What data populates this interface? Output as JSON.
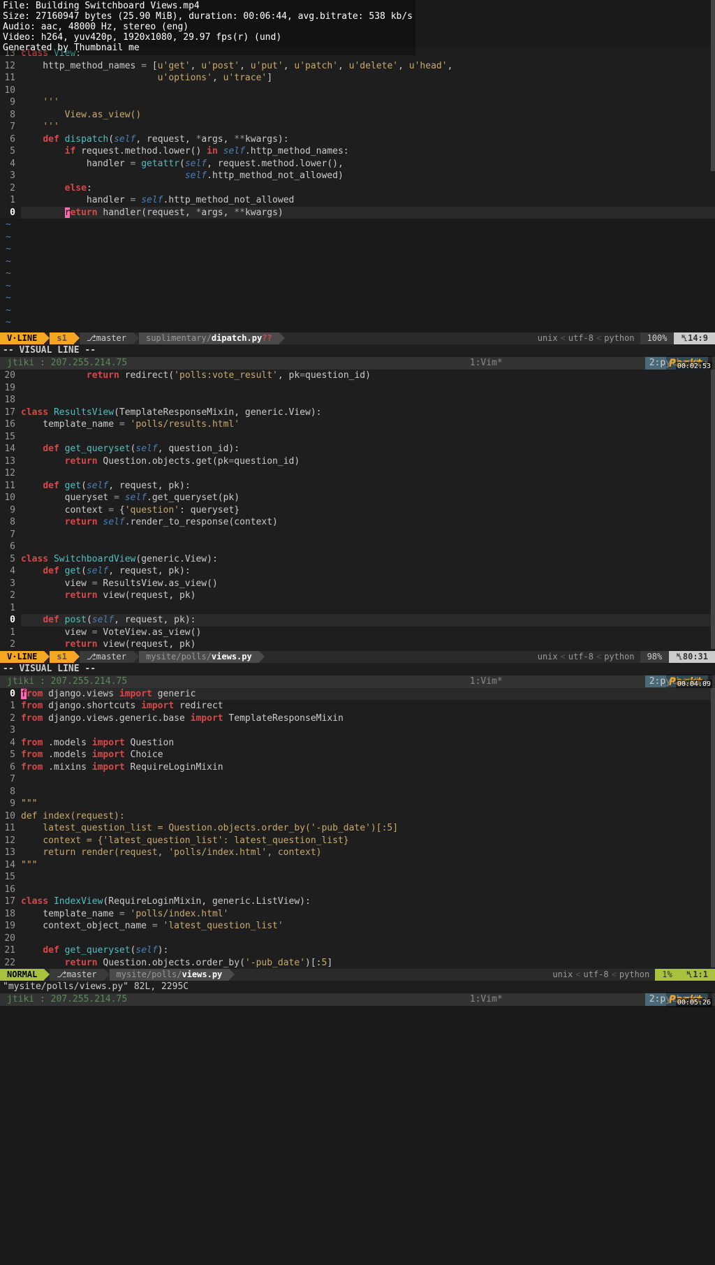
{
  "meta": {
    "file": "File: Building Switchboard Views.mp4",
    "size": "Size: 27160947 bytes (25.90 MiB), duration: 00:06:44, avg.bitrate: 538 kb/s",
    "audio": "Audio: aac, 48000 Hz, stereo (eng)",
    "video": "Video: h264, yuv420p, 1920x1080, 29.97 fps(r) (und)",
    "gen": "Generated by Thumbnail me"
  },
  "pane1": {
    "gutter": [
      "13",
      "12",
      "11",
      "10",
      "9",
      "8",
      "7",
      "6",
      "5",
      "4",
      "3",
      "2",
      "1",
      "0"
    ],
    "lines": [
      {
        "pre": "",
        "tokens": [
          {
            "c": "kw-red",
            "t": "class"
          },
          {
            "t": " "
          },
          {
            "c": "kw-cyan",
            "t": "View"
          },
          {
            "t": ":"
          }
        ]
      },
      {
        "pre": "    ",
        "tokens": [
          {
            "t": "http_method_names "
          },
          {
            "c": "kw-op",
            "t": "="
          },
          {
            "t": " ["
          },
          {
            "c": "kw-str",
            "t": "u'get'"
          },
          {
            "t": ", "
          },
          {
            "c": "kw-str",
            "t": "u'post'"
          },
          {
            "t": ", "
          },
          {
            "c": "kw-str",
            "t": "u'put'"
          },
          {
            "t": ", "
          },
          {
            "c": "kw-str",
            "t": "u'patch'"
          },
          {
            "t": ", "
          },
          {
            "c": "kw-str",
            "t": "u'delete'"
          },
          {
            "t": ", "
          },
          {
            "c": "kw-str",
            "t": "u'head'"
          },
          {
            "t": ","
          }
        ]
      },
      {
        "pre": "                         ",
        "tokens": [
          {
            "c": "kw-str",
            "t": "u'options'"
          },
          {
            "t": ", "
          },
          {
            "c": "kw-str",
            "t": "u'trace'"
          },
          {
            "t": "]"
          }
        ]
      },
      {
        "pre": "",
        "tokens": []
      },
      {
        "pre": "    ",
        "tokens": [
          {
            "c": "kw-str",
            "t": "'''"
          }
        ]
      },
      {
        "pre": "        ",
        "tokens": [
          {
            "c": "kw-str",
            "t": "View.as_view()"
          }
        ]
      },
      {
        "pre": "    ",
        "tokens": [
          {
            "c": "kw-str",
            "t": "'''"
          }
        ]
      },
      {
        "pre": "    ",
        "tokens": [
          {
            "c": "kw-red",
            "t": "def"
          },
          {
            "t": " "
          },
          {
            "c": "kw-cyan",
            "t": "dispatch"
          },
          {
            "t": "("
          },
          {
            "c": "kw-self",
            "t": "self"
          },
          {
            "t": ", request, "
          },
          {
            "c": "kw-op",
            "t": "*"
          },
          {
            "t": "args, "
          },
          {
            "c": "kw-op",
            "t": "**"
          },
          {
            "t": "kwargs):"
          }
        ]
      },
      {
        "pre": "        ",
        "tokens": [
          {
            "c": "kw-red",
            "t": "if"
          },
          {
            "t": " request.method.lower() "
          },
          {
            "c": "kw-red",
            "t": "in"
          },
          {
            "t": " "
          },
          {
            "c": "kw-self",
            "t": "self"
          },
          {
            "t": ".http_method_names:"
          }
        ]
      },
      {
        "pre": "            ",
        "tokens": [
          {
            "t": "handler "
          },
          {
            "c": "kw-op",
            "t": "="
          },
          {
            "t": " "
          },
          {
            "c": "kw-cyan",
            "t": "getattr"
          },
          {
            "t": "("
          },
          {
            "c": "kw-self",
            "t": "self"
          },
          {
            "t": ", request.method.lower(),"
          }
        ]
      },
      {
        "pre": "                              ",
        "tokens": [
          {
            "c": "kw-self",
            "t": "self"
          },
          {
            "t": ".http_method_not_allowed)"
          }
        ]
      },
      {
        "pre": "        ",
        "tokens": [
          {
            "c": "kw-red",
            "t": "else"
          },
          {
            "t": ":"
          }
        ]
      },
      {
        "pre": "            ",
        "tokens": [
          {
            "t": "handler "
          },
          {
            "c": "kw-op",
            "t": "="
          },
          {
            "t": " "
          },
          {
            "c": "kw-self",
            "t": "self"
          },
          {
            "t": ".http_method_not_allowed"
          }
        ]
      },
      {
        "pre": "        ",
        "hl": true,
        "tokens": [
          {
            "c": "cursor-hl",
            "t": "r"
          },
          {
            "c": "kw-red",
            "t": "eturn"
          },
          {
            "t": " handler(request, "
          },
          {
            "c": "kw-op",
            "t": "*"
          },
          {
            "t": "args, "
          },
          {
            "c": "kw-op",
            "t": "**"
          },
          {
            "t": "kwargs)"
          }
        ]
      }
    ],
    "status": {
      "mode": "V·LINE",
      "s1": "s1",
      "branch": "master",
      "path": "suplimentary/",
      "file": "dipatch.py",
      "warn": "??",
      "enc": "unix",
      "charset": "utf-8",
      "ft": "python",
      "pct": "100%",
      "pos": "14:9"
    },
    "cmd": "-- VISUAL LINE --",
    "tmux": {
      "host": "jtiki : 207.255.214.75",
      "vim": "1:Vim*",
      "py": "2:python#-",
      "packt": "Packt",
      "ts": "00:02:53"
    }
  },
  "pane2": {
    "gutter": [
      "20",
      "19",
      "18",
      "17",
      "16",
      "15",
      "14",
      "13",
      "12",
      "11",
      "10",
      "9",
      "8",
      "7",
      "6",
      "5",
      "4",
      "3",
      "2",
      "1",
      "0",
      "1",
      "2"
    ],
    "lines": [
      {
        "pre": "            ",
        "tokens": [
          {
            "c": "kw-red",
            "t": "return"
          },
          {
            "t": " redirect("
          },
          {
            "c": "kw-str",
            "t": "'polls:vote_result'"
          },
          {
            "t": ", pk"
          },
          {
            "c": "kw-op",
            "t": "="
          },
          {
            "t": "question_id)"
          }
        ]
      },
      {
        "pre": "",
        "tokens": []
      },
      {
        "pre": "",
        "tokens": []
      },
      {
        "pre": "",
        "tokens": [
          {
            "c": "kw-red",
            "t": "class"
          },
          {
            "t": " "
          },
          {
            "c": "kw-cyan",
            "t": "ResultsView"
          },
          {
            "t": "(TemplateResponseMixin, generic.View):"
          }
        ]
      },
      {
        "pre": "    ",
        "tokens": [
          {
            "t": "template_name "
          },
          {
            "c": "kw-op",
            "t": "="
          },
          {
            "t": " "
          },
          {
            "c": "kw-str",
            "t": "'polls/results.html'"
          }
        ]
      },
      {
        "pre": "",
        "tokens": []
      },
      {
        "pre": "    ",
        "tokens": [
          {
            "c": "kw-red",
            "t": "def"
          },
          {
            "t": " "
          },
          {
            "c": "kw-cyan",
            "t": "get_queryset"
          },
          {
            "t": "("
          },
          {
            "c": "kw-self",
            "t": "self"
          },
          {
            "t": ", question_id):"
          }
        ]
      },
      {
        "pre": "        ",
        "tokens": [
          {
            "c": "kw-red",
            "t": "return"
          },
          {
            "t": " Question.objects.get(pk"
          },
          {
            "c": "kw-op",
            "t": "="
          },
          {
            "t": "question_id)"
          }
        ]
      },
      {
        "pre": "",
        "tokens": []
      },
      {
        "pre": "    ",
        "tokens": [
          {
            "c": "kw-red",
            "t": "def"
          },
          {
            "t": " "
          },
          {
            "c": "kw-cyan",
            "t": "get"
          },
          {
            "t": "("
          },
          {
            "c": "kw-self",
            "t": "self"
          },
          {
            "t": ", request, pk):"
          }
        ]
      },
      {
        "pre": "        ",
        "tokens": [
          {
            "t": "queryset "
          },
          {
            "c": "kw-op",
            "t": "="
          },
          {
            "t": " "
          },
          {
            "c": "kw-self",
            "t": "self"
          },
          {
            "t": ".get_queryset(pk)"
          }
        ]
      },
      {
        "pre": "        ",
        "tokens": [
          {
            "t": "context "
          },
          {
            "c": "kw-op",
            "t": "="
          },
          {
            "t": " {"
          },
          {
            "c": "kw-str",
            "t": "'question'"
          },
          {
            "t": ": queryset}"
          }
        ]
      },
      {
        "pre": "        ",
        "tokens": [
          {
            "c": "kw-red",
            "t": "return"
          },
          {
            "t": " "
          },
          {
            "c": "kw-self",
            "t": "self"
          },
          {
            "t": ".render_to_response(context)"
          }
        ]
      },
      {
        "pre": "",
        "tokens": []
      },
      {
        "pre": "",
        "tokens": []
      },
      {
        "pre": "",
        "tokens": [
          {
            "c": "kw-red",
            "t": "class"
          },
          {
            "t": " "
          },
          {
            "c": "kw-cyan",
            "t": "SwitchboardView"
          },
          {
            "t": "(generic.View):"
          }
        ]
      },
      {
        "pre": "    ",
        "tokens": [
          {
            "c": "kw-red",
            "t": "def"
          },
          {
            "t": " "
          },
          {
            "c": "kw-cyan",
            "t": "get"
          },
          {
            "t": "("
          },
          {
            "c": "kw-self",
            "t": "self"
          },
          {
            "t": ", request, pk):"
          }
        ]
      },
      {
        "pre": "        ",
        "tokens": [
          {
            "t": "view "
          },
          {
            "c": "kw-op",
            "t": "="
          },
          {
            "t": " ResultsView.as_view()"
          }
        ]
      },
      {
        "pre": "        ",
        "tokens": [
          {
            "c": "kw-red",
            "t": "return"
          },
          {
            "t": " view(request, pk)"
          }
        ]
      },
      {
        "pre": "",
        "tokens": []
      },
      {
        "pre": "    ",
        "hl": true,
        "tokens": [
          {
            "c": "kw-red",
            "t": "def"
          },
          {
            "t": " "
          },
          {
            "c": "kw-cyan",
            "t": "post"
          },
          {
            "t": "("
          },
          {
            "c": "kw-self",
            "t": "self"
          },
          {
            "t": ", request, pk):"
          }
        ]
      },
      {
        "pre": "        ",
        "tokens": [
          {
            "t": "view "
          },
          {
            "c": "kw-op",
            "t": "="
          },
          {
            "t": " VoteView.as_view()"
          }
        ]
      },
      {
        "pre": "        ",
        "tokens": [
          {
            "c": "kw-red",
            "t": "return"
          },
          {
            "t": " view(request, pk)"
          }
        ]
      }
    ],
    "status": {
      "mode": "V·LINE",
      "s1": "s1",
      "branch": "master",
      "path": "mysite/polls/",
      "file": "views.py",
      "enc": "unix",
      "charset": "utf-8",
      "ft": "python",
      "pct": "98%",
      "pos": "80:31"
    },
    "cmd": "-- VISUAL LINE --",
    "tmux": {
      "host": "jtiki : 207.255.214.75",
      "vim": "1:Vim*",
      "py": "2:python#-",
      "packt": "Packt",
      "ts": "00:04:09"
    }
  },
  "pane3": {
    "gutter": [
      "0",
      "1",
      "2",
      "3",
      "4",
      "5",
      "6",
      "7",
      "8",
      "9",
      "10",
      "11",
      "12",
      "13",
      "14",
      "15",
      "16",
      "17",
      "18",
      "19",
      "20",
      "21",
      "22"
    ],
    "lines": [
      {
        "pre": "",
        "hl": true,
        "tokens": [
          {
            "c": "cursor-hl",
            "t": "f"
          },
          {
            "c": "kw-red",
            "t": "rom"
          },
          {
            "t": " django.views "
          },
          {
            "c": "kw-red",
            "t": "import"
          },
          {
            "t": " generic"
          }
        ]
      },
      {
        "pre": "",
        "tokens": [
          {
            "c": "kw-red",
            "t": "from"
          },
          {
            "t": " django.shortcuts "
          },
          {
            "c": "kw-red",
            "t": "import"
          },
          {
            "t": " redirect"
          }
        ]
      },
      {
        "pre": "",
        "tokens": [
          {
            "c": "kw-red",
            "t": "from"
          },
          {
            "t": " django.views.generic.base "
          },
          {
            "c": "kw-red",
            "t": "import"
          },
          {
            "t": " TemplateResponseMixin"
          }
        ]
      },
      {
        "pre": "",
        "tokens": []
      },
      {
        "pre": "",
        "tokens": [
          {
            "c": "kw-red",
            "t": "from"
          },
          {
            "t": " .models "
          },
          {
            "c": "kw-red",
            "t": "import"
          },
          {
            "t": " Question"
          }
        ]
      },
      {
        "pre": "",
        "tokens": [
          {
            "c": "kw-red",
            "t": "from"
          },
          {
            "t": " .models "
          },
          {
            "c": "kw-red",
            "t": "import"
          },
          {
            "t": " Choice"
          }
        ]
      },
      {
        "pre": "",
        "tokens": [
          {
            "c": "kw-red",
            "t": "from"
          },
          {
            "t": " .mixins "
          },
          {
            "c": "kw-red",
            "t": "import"
          },
          {
            "t": " RequireLoginMixin"
          }
        ]
      },
      {
        "pre": "",
        "tokens": []
      },
      {
        "pre": "",
        "tokens": []
      },
      {
        "pre": "",
        "tokens": [
          {
            "c": "kw-str",
            "t": "\"\"\""
          }
        ]
      },
      {
        "pre": "",
        "tokens": [
          {
            "c": "kw-str",
            "t": "def index(request):"
          }
        ]
      },
      {
        "pre": "    ",
        "tokens": [
          {
            "c": "kw-str",
            "t": "latest_question_list = Question.objects.order_by('-pub_date')[:5]"
          }
        ]
      },
      {
        "pre": "    ",
        "tokens": [
          {
            "c": "kw-str",
            "t": "context = {'latest_question_list': latest_question_list}"
          }
        ]
      },
      {
        "pre": "    ",
        "tokens": [
          {
            "c": "kw-str",
            "t": "return render(request, 'polls/index.html', context)"
          }
        ]
      },
      {
        "pre": "",
        "tokens": [
          {
            "c": "kw-str",
            "t": "\"\"\""
          }
        ]
      },
      {
        "pre": "",
        "tokens": []
      },
      {
        "pre": "",
        "tokens": []
      },
      {
        "pre": "",
        "tokens": [
          {
            "c": "kw-red",
            "t": "class"
          },
          {
            "t": " "
          },
          {
            "c": "kw-cyan",
            "t": "IndexView"
          },
          {
            "t": "(RequireLoginMixin, generic.ListView):"
          }
        ]
      },
      {
        "pre": "    ",
        "tokens": [
          {
            "t": "template_name "
          },
          {
            "c": "kw-op",
            "t": "="
          },
          {
            "t": " "
          },
          {
            "c": "kw-str",
            "t": "'polls/index.html'"
          }
        ]
      },
      {
        "pre": "    ",
        "tokens": [
          {
            "t": "context_object_name "
          },
          {
            "c": "kw-op",
            "t": "="
          },
          {
            "t": " "
          },
          {
            "c": "kw-str",
            "t": "'latest_question_list'"
          }
        ]
      },
      {
        "pre": "",
        "tokens": []
      },
      {
        "pre": "    ",
        "tokens": [
          {
            "c": "kw-red",
            "t": "def"
          },
          {
            "t": " "
          },
          {
            "c": "kw-cyan",
            "t": "get_queryset"
          },
          {
            "t": "("
          },
          {
            "c": "kw-self",
            "t": "self"
          },
          {
            "t": "):"
          }
        ]
      },
      {
        "pre": "        ",
        "tokens": [
          {
            "c": "kw-red",
            "t": "return"
          },
          {
            "t": " Question.objects.order_by("
          },
          {
            "c": "kw-str",
            "t": "'-pub_date'"
          },
          {
            "t": ")[:"
          },
          {
            "c": "kw-num",
            "t": "5"
          },
          {
            "t": "]"
          }
        ]
      }
    ],
    "status": {
      "mode": "NORMAL",
      "branch": "master",
      "path": "mysite/polls/",
      "file": "views.py",
      "enc": "unix",
      "charset": "utf-8",
      "ft": "python",
      "pct": "1%",
      "pos": "1:1"
    },
    "cmd": "\"mysite/polls/views.py\" 82L, 2295C",
    "tmux": {
      "host": "jtiki : 207.255.214.75",
      "vim": "1:Vim*",
      "py": "2:python#-",
      "packt": "Packt",
      "ts": "00:05:26"
    }
  }
}
